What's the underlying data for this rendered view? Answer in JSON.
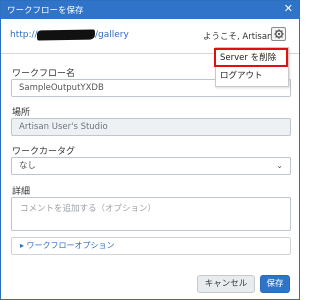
{
  "window": {
    "title": "ワークフローを保存",
    "close_glyph": "✕"
  },
  "header": {
    "url_prefix": "http://",
    "url_suffix": "/gallery",
    "welcome": "ようこそ, Artisan",
    "settings_icon": "gear-icon"
  },
  "menu": {
    "items": [
      {
        "label": "Server を削除"
      },
      {
        "label": "ログアウト"
      }
    ],
    "highlight_color": "#e01010"
  },
  "form": {
    "name_label": "ワークフロー名",
    "name_value": "SampleOutputYXDB",
    "location_label": "場所",
    "location_value": "Artisan User's Studio",
    "tag_label": "ワークカータグ",
    "tag_value": "なし",
    "details_label": "詳細",
    "details_placeholder": "コメントを追加する（オプション）",
    "options_label": "▸ ワークフローオプション"
  },
  "footer": {
    "cancel_label": "キャンセル",
    "save_label": "保存"
  },
  "colors": {
    "accent": "#2f74c9",
    "link": "#2f6fbd"
  }
}
